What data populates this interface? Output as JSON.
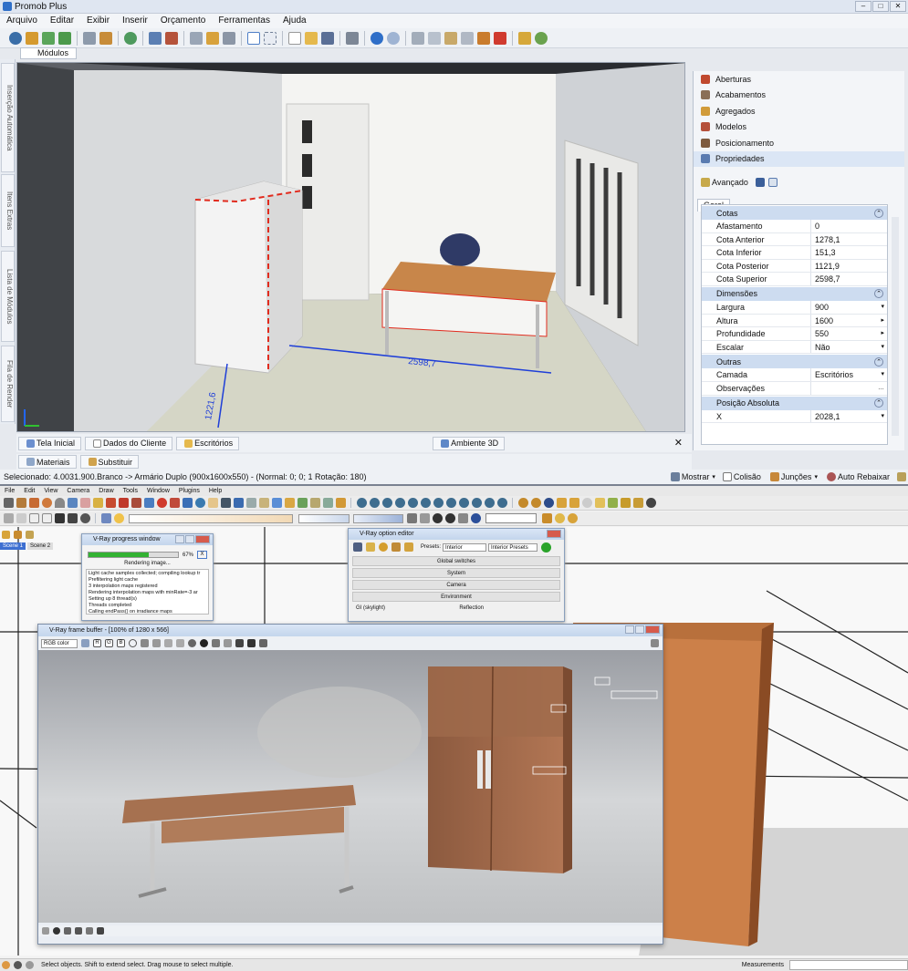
{
  "app": {
    "title": "Promob Plus"
  },
  "menu": [
    "Arquivo",
    "Editar",
    "Exibir",
    "Inserir",
    "Orçamento",
    "Ferramentas",
    "Ajuda"
  ],
  "modules_tab": "Módulos",
  "left_tabs": [
    "Inserção Automática",
    "Itens Extras",
    "Lista de Módulos",
    "Fila de Render"
  ],
  "viewport": {
    "dimension_1": "2598,7",
    "dimension_2": "1221,6"
  },
  "viewport_tabs": {
    "home": "Tela Inicial",
    "client": "Dados do Cliente",
    "project": "Escritórios",
    "env3d": "Ambiente 3D"
  },
  "right_panel": {
    "items": [
      "Aberturas",
      "Acabamentos",
      "Agregados",
      "Modelos",
      "Posicionamento",
      "Propriedades"
    ],
    "advanced_label": "Avançado",
    "general_tab": "Geral",
    "sections": [
      {
        "title": "Cotas",
        "rows": [
          {
            "name": "Afastamento",
            "value": "0"
          },
          {
            "name": "Cota Anterior",
            "value": "1278,1"
          },
          {
            "name": "Cota Inferior",
            "value": "151,3"
          },
          {
            "name": "Cota Posterior",
            "value": "1121,9"
          },
          {
            "name": "Cota Superior",
            "value": "2598,7"
          }
        ]
      },
      {
        "title": "Dimensões",
        "rows": [
          {
            "name": "Largura",
            "value": "900"
          },
          {
            "name": "Altura",
            "value": "1600"
          },
          {
            "name": "Profundidade",
            "value": "550"
          },
          {
            "name": "Escalar",
            "value": "Não"
          }
        ]
      },
      {
        "title": "Outras",
        "rows": [
          {
            "name": "Camada",
            "value": "Escritórios"
          },
          {
            "name": "Observações",
            "value": ""
          }
        ]
      },
      {
        "title": "Posição Absoluta",
        "rows": [
          {
            "name": "X",
            "value": "2028,1"
          }
        ]
      }
    ]
  },
  "lower_tabs": {
    "materials": "Materiais",
    "replace": "Substituir"
  },
  "status": {
    "selected": "Selecionado: 4.0031.900.Branco -> Armário Duplo (900x1600x550) - (Normal: 0; 0; 1 Rotação: 180)",
    "show": "Mostrar",
    "collision": "Colisão",
    "joints": "Junções",
    "auto_lower": "Auto Rebaixar"
  },
  "sketchup": {
    "menu": [
      "File",
      "Edit",
      "View",
      "Camera",
      "Draw",
      "Tools",
      "Window",
      "Plugins",
      "Help"
    ],
    "scenes": [
      "Scene 1",
      "Scene 2"
    ],
    "status_text": "Select objects. Shift to extend select. Drag mouse to select multiple.",
    "measurements": "Measurements"
  },
  "vray_progress": {
    "title": "V-Ray progress window",
    "percent": "67%",
    "progress": 0.67,
    "status": "Rendering image...",
    "log": [
      "Light cache samples collected; compiling lookup tr",
      "Prefiltering light cache",
      "3 interpolation maps registered",
      "Rendering interpolation maps with minRate=-3 ar",
      "Setting up 8 thread(s)",
      "Threads completed",
      "Calling endPass() on irradiance maps"
    ]
  },
  "vray_options": {
    "title": "V-Ray option editor",
    "presets_label": "Presets:",
    "preset_1": "Interior",
    "preset_2": "Interior Presets",
    "sections": [
      "Global switches",
      "System",
      "Camera",
      "Environment"
    ],
    "gi_label": "GI (skylight)",
    "reflection_label": "Reflection"
  },
  "vray_fb": {
    "title": "V-Ray frame buffer - [100% of 1280 x 566]",
    "channel": "RGB color"
  }
}
